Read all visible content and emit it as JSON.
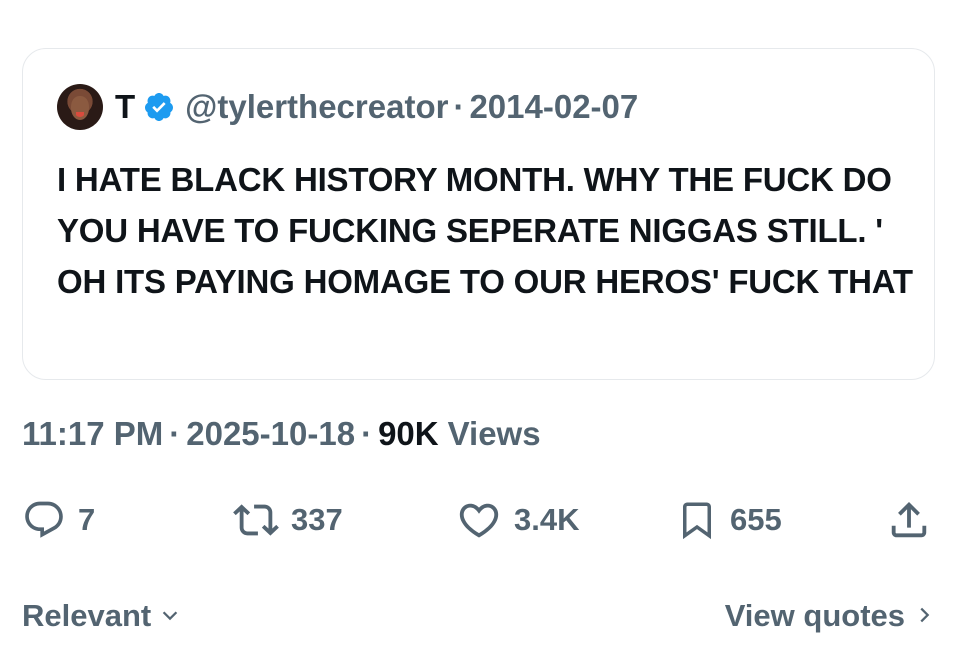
{
  "quoted_tweet": {
    "author_name": "T",
    "handle": "@tylerthecreator",
    "separator": "·",
    "date": "2014-02-07",
    "text": "I HATE BLACK HISTORY MONTH. WHY THE FUCK DO YOU HAVE TO FUCKING SEPERATE NIGGAS STILL. ' OH ITS PAYING HOMAGE TO OUR HEROS' FUCK THAT",
    "verified_color": "#1d9bf0"
  },
  "meta": {
    "time": "11:17 PM",
    "separator": "·",
    "date": "2025-10-18",
    "views_count": "90K",
    "views_label": "Views"
  },
  "actions": {
    "replies": "7",
    "reposts": "337",
    "likes": "3.4K",
    "bookmarks": "655"
  },
  "bottom": {
    "sort_label": "Relevant",
    "view_quotes_label": "View quotes"
  },
  "colors": {
    "text_primary": "#0f1419",
    "text_secondary": "#536471",
    "border": "#e6e9ec"
  }
}
